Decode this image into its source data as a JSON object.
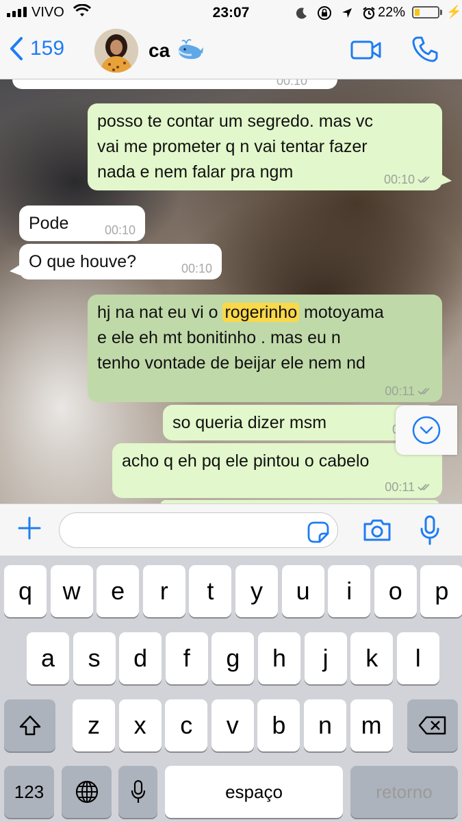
{
  "status_bar": {
    "carrier": "VIVO",
    "time": "23:07",
    "battery_percent_label": "22%",
    "battery_level": 0.22
  },
  "nav": {
    "back_count": "159",
    "contact_name": "ca",
    "contact_emoji_icon": "whale-icon"
  },
  "messages": [
    {
      "direction": "out",
      "text": "posso te contar um segredo. mas vc\nvai me prometer q n vai tentar fazer\nnada e nem falar pra ngm",
      "time": "00:10",
      "ticks": "double-check-icon"
    },
    {
      "direction": "in",
      "text": "Pode",
      "time": "00:10"
    },
    {
      "direction": "in",
      "text": "O que houve?",
      "time": "00:10"
    },
    {
      "direction": "out",
      "selected": true,
      "text_before": "hj na nat eu vi o ",
      "highlight": "rogerinho",
      "text_after": " motoyama\ne ele eh mt bonitinho . mas eu n\ntenho vontade de beijar ele nem nd",
      "time": "00:11",
      "ticks": "double-check-icon"
    },
    {
      "direction": "out",
      "text": "so queria dizer msm",
      "time": "00:"
    },
    {
      "direction": "out",
      "text": "acho q eh pq ele pintou o cabelo",
      "time": "00:11",
      "ticks": "double-check-icon"
    }
  ],
  "top_cut_time": "00:10",
  "input": {
    "placeholder": "",
    "value": ""
  },
  "keyboard": {
    "row1": [
      "q",
      "w",
      "e",
      "r",
      "t",
      "y",
      "u",
      "i",
      "o",
      "p"
    ],
    "row2": [
      "a",
      "s",
      "d",
      "f",
      "g",
      "h",
      "j",
      "k",
      "l"
    ],
    "row3": [
      "z",
      "x",
      "c",
      "v",
      "b",
      "n",
      "m"
    ],
    "numbers_label": "123",
    "space_label": "espaço",
    "return_label": "retorno"
  },
  "colors": {
    "accent": "#1e7cf2",
    "outgoing_bubble": "#e2f7cb",
    "incoming_bubble": "#ffffff",
    "highlight": "#f9d84a",
    "battery_fill": "#f5c518"
  }
}
